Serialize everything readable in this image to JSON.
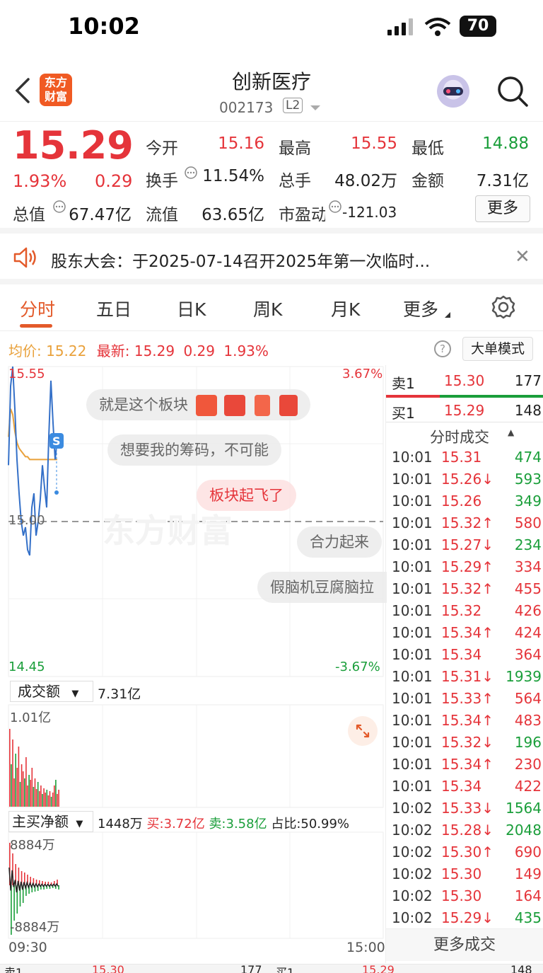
{
  "status_bar": {
    "time": "10:02",
    "battery": "70"
  },
  "header": {
    "logo_text": "东方财富",
    "stock_name": "创新医疗",
    "stock_code": "002173",
    "level_badge": "L2"
  },
  "quote": {
    "price": "15.29",
    "change_pct": "1.93%",
    "change": "0.29",
    "fields": [
      {
        "label": "今开",
        "value": "15.16",
        "color": "#e5343a"
      },
      {
        "label": "最高",
        "value": "15.55",
        "color": "#e5343a"
      },
      {
        "label": "最低",
        "value": "14.88",
        "color": "#1a9e3a"
      },
      {
        "label": "换手",
        "value": "11.54%",
        "color": "#222222"
      },
      {
        "label": "总手",
        "value": "48.02万",
        "color": "#222222"
      },
      {
        "label": "金额",
        "value": "7.31亿",
        "color": "#222222"
      },
      {
        "label": "总值",
        "value": "67.47亿",
        "color": "#222222"
      },
      {
        "label": "流值",
        "value": "63.65亿",
        "color": "#222222"
      },
      {
        "label": "市盈动",
        "value": "-121.03",
        "color": "#222222"
      }
    ],
    "more_label": "更多"
  },
  "notice": {
    "text": "股东大会：于2025-07-14召开2025年第一次临时..."
  },
  "tabs": [
    "分时",
    "五日",
    "日K",
    "周K",
    "月K",
    "更多"
  ],
  "info_line": {
    "avg_label": "均价:",
    "avg_value": "15.22",
    "latest_label": "最新:",
    "latest_value": "15.29",
    "change": "0.29",
    "change_pct": "1.93%",
    "mode_label": "大单模式"
  },
  "chart": {
    "price_max": "15.55",
    "price_mid": "15.00",
    "price_min": "14.45",
    "pct_max": "3.67%",
    "pct_min": "-3.67%",
    "volume_label": "成交额",
    "volume_total": "7.31亿",
    "volume_max": "1.01亿",
    "flow_label": "主买净额",
    "flow_value": "1448万",
    "flow_buy": "买:3.72亿",
    "flow_sell": "卖:3.58亿",
    "flow_ratio": "占比:50.99%",
    "flow_max": "8884万",
    "flow_min": "-8884万",
    "time_start": "09:30",
    "time_end": "15:00",
    "watermark": "东方财富",
    "s_marker": "S"
  },
  "chart_data": {
    "type": "line",
    "title": "",
    "xlabel": "",
    "ylabel": "",
    "ylim": [
      14.45,
      15.55
    ],
    "x_range": [
      "09:30",
      "15:00"
    ],
    "series": [
      {
        "name": "最新",
        "color": "#3470c8",
        "values": [
          15.2,
          15.48,
          15.55,
          15.4,
          15.22,
          15.1,
          15.0,
          14.95,
          14.98,
          14.9,
          14.88,
          15.05,
          15.1,
          14.95,
          15.0,
          15.08,
          15.2,
          15.12,
          15.05,
          15.3,
          15.5,
          15.35,
          15.22,
          15.29
        ]
      },
      {
        "name": "均价",
        "color": "#e9a13b",
        "values": [
          15.3,
          15.4,
          15.38,
          15.32,
          15.28,
          15.26,
          15.25,
          15.24,
          15.23,
          15.23,
          15.22,
          15.22,
          15.22,
          15.22,
          15.22,
          15.22,
          15.22,
          15.22,
          15.22,
          15.22,
          15.22,
          15.22,
          15.22,
          15.22
        ]
      }
    ]
  },
  "bubbles": [
    {
      "text": "就是这个板块",
      "style": "gray"
    },
    {
      "text": "想要我的筹码，不可能",
      "style": "gray"
    },
    {
      "text": "板块起飞了",
      "style": "red"
    },
    {
      "text": "合力起来",
      "style": "gray"
    },
    {
      "text": "假脑机豆腐脑拉",
      "style": "gray"
    }
  ],
  "order_book": {
    "sell1": {
      "label": "卖1",
      "price": "15.30",
      "volume": "177"
    },
    "buy1": {
      "label": "买1",
      "price": "15.29",
      "volume": "148"
    }
  },
  "trades": {
    "title": "分时成交",
    "rows": [
      {
        "time": "10:01",
        "price": "15.31",
        "arrow": "",
        "volume": "474",
        "vol_color": "#1a9e3a"
      },
      {
        "time": "10:01",
        "price": "15.26",
        "arrow": "↓",
        "volume": "593",
        "vol_color": "#1a9e3a"
      },
      {
        "time": "10:01",
        "price": "15.26",
        "arrow": "",
        "volume": "349",
        "vol_color": "#1a9e3a"
      },
      {
        "time": "10:01",
        "price": "15.32",
        "arrow": "↑",
        "volume": "580",
        "vol_color": "#e5343a"
      },
      {
        "time": "10:01",
        "price": "15.27",
        "arrow": "↓",
        "volume": "234",
        "vol_color": "#1a9e3a"
      },
      {
        "time": "10:01",
        "price": "15.29",
        "arrow": "↑",
        "volume": "334",
        "vol_color": "#e5343a"
      },
      {
        "time": "10:01",
        "price": "15.32",
        "arrow": "↑",
        "volume": "455",
        "vol_color": "#e5343a"
      },
      {
        "time": "10:01",
        "price": "15.32",
        "arrow": "",
        "volume": "426",
        "vol_color": "#e5343a"
      },
      {
        "time": "10:01",
        "price": "15.34",
        "arrow": "↑",
        "volume": "424",
        "vol_color": "#e5343a"
      },
      {
        "time": "10:01",
        "price": "15.34",
        "arrow": "",
        "volume": "364",
        "vol_color": "#e5343a"
      },
      {
        "time": "10:01",
        "price": "15.31",
        "arrow": "↓",
        "volume": "1939",
        "vol_color": "#1a9e3a"
      },
      {
        "time": "10:01",
        "price": "15.33",
        "arrow": "↑",
        "volume": "564",
        "vol_color": "#e5343a"
      },
      {
        "time": "10:01",
        "price": "15.34",
        "arrow": "↑",
        "volume": "483",
        "vol_color": "#e5343a"
      },
      {
        "time": "10:01",
        "price": "15.32",
        "arrow": "↓",
        "volume": "196",
        "vol_color": "#1a9e3a"
      },
      {
        "time": "10:01",
        "price": "15.34",
        "arrow": "↑",
        "volume": "230",
        "vol_color": "#e5343a"
      },
      {
        "time": "10:01",
        "price": "15.34",
        "arrow": "",
        "volume": "422",
        "vol_color": "#e5343a"
      },
      {
        "time": "10:02",
        "price": "15.33",
        "arrow": "↓",
        "volume": "1564",
        "vol_color": "#1a9e3a"
      },
      {
        "time": "10:02",
        "price": "15.28",
        "arrow": "↓",
        "volume": "2048",
        "vol_color": "#1a9e3a"
      },
      {
        "time": "10:02",
        "price": "15.30",
        "arrow": "↑",
        "volume": "690",
        "vol_color": "#e5343a"
      },
      {
        "time": "10:02",
        "price": "15.30",
        "arrow": "",
        "volume": "149",
        "vol_color": "#e5343a"
      },
      {
        "time": "10:02",
        "price": "15.30",
        "arrow": "",
        "volume": "164",
        "vol_color": "#e5343a"
      },
      {
        "time": "10:02",
        "price": "15.29",
        "arrow": "↓",
        "volume": "435",
        "vol_color": "#1a9e3a"
      }
    ],
    "more_label": "更多成交"
  },
  "icons": {
    "back": "back-arrow-icon",
    "search": "search-icon",
    "speaker": "speaker-icon",
    "close": "close-icon",
    "settings": "gear-icon",
    "expand": "expand-icon",
    "help": "help-icon"
  },
  "colors": {
    "up": "#e5343a",
    "down": "#1a9e3a",
    "accent": "#e35a2a",
    "avg": "#e9a13b"
  }
}
